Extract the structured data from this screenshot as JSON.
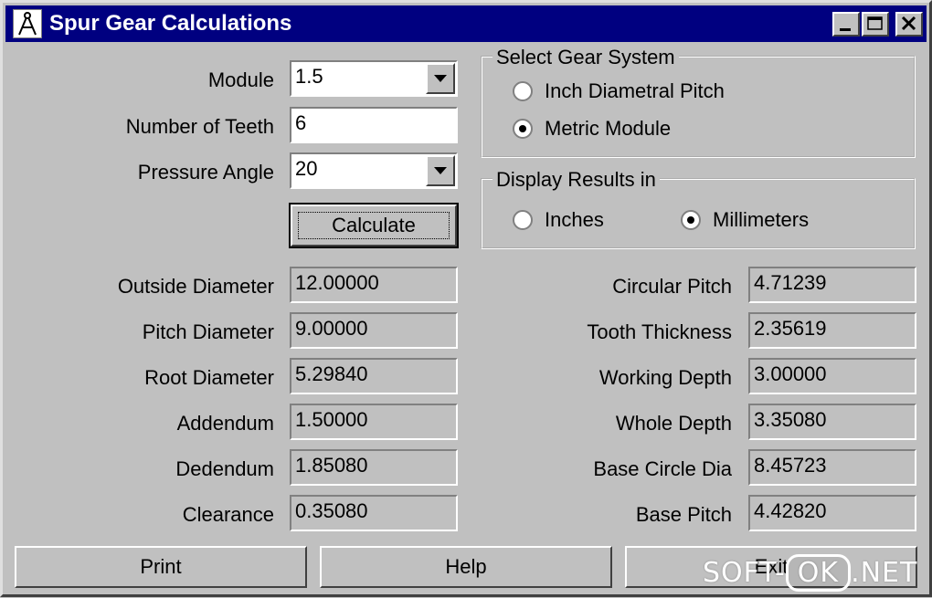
{
  "window": {
    "title": "Spur Gear Calculations"
  },
  "inputs": {
    "module": {
      "label": "Module",
      "value": "1.5"
    },
    "teeth": {
      "label": "Number of Teeth",
      "value": "6"
    },
    "pressure_angle": {
      "label": "Pressure Angle",
      "value": "20"
    }
  },
  "calculate_label": "Calculate",
  "gear_system": {
    "title": "Select Gear System",
    "options": [
      {
        "label": "Inch Diametral Pitch",
        "selected": false
      },
      {
        "label": "Metric Module",
        "selected": true
      }
    ]
  },
  "display_results": {
    "title": "Display Results in",
    "options": [
      {
        "label": "Inches",
        "selected": false
      },
      {
        "label": "Millimeters",
        "selected": true
      }
    ]
  },
  "results_left": [
    {
      "label": "Outside Diameter",
      "value": "12.00000"
    },
    {
      "label": "Pitch Diameter",
      "value": "9.00000"
    },
    {
      "label": "Root Diameter",
      "value": "5.29840"
    },
    {
      "label": "Addendum",
      "value": "1.50000"
    },
    {
      "label": "Dedendum",
      "value": "1.85080"
    },
    {
      "label": "Clearance",
      "value": "0.35080"
    }
  ],
  "results_right": [
    {
      "label": "Circular Pitch",
      "value": "4.71239"
    },
    {
      "label": "Tooth Thickness",
      "value": "2.35619"
    },
    {
      "label": "Working Depth",
      "value": "3.00000"
    },
    {
      "label": "Whole Depth",
      "value": "3.35080"
    },
    {
      "label": "Base Circle Dia",
      "value": "8.45723"
    },
    {
      "label": "Base Pitch",
      "value": "4.42820"
    }
  ],
  "buttons": {
    "print": "Print",
    "help": "Help",
    "exit": "Exit"
  },
  "watermark": {
    "left": "SOFT-",
    "ok": "OK",
    "right": ".NET"
  }
}
